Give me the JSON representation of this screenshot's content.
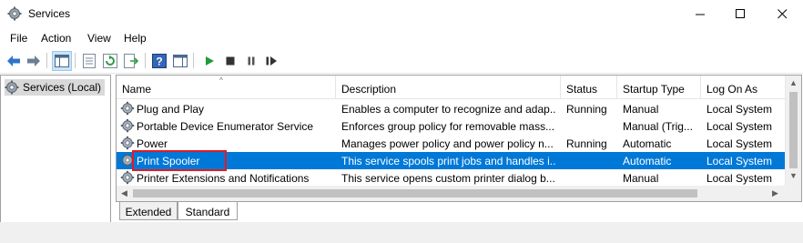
{
  "window": {
    "title": "Services",
    "minimize_glyph": "—",
    "maximize_glyph": "☐",
    "close_glyph": "✕"
  },
  "menu": [
    "File",
    "Action",
    "View",
    "Help"
  ],
  "toolbar_icons": [
    "back-icon",
    "forward-icon",
    "show-hide-console-tree-icon",
    "properties-icon",
    "refresh-icon",
    "export-list-icon",
    "help-icon",
    "show-action-pane-icon",
    "start-service-icon",
    "stop-service-icon",
    "pause-service-icon",
    "restart-service-icon"
  ],
  "tree": {
    "selected_label": "Services (Local)"
  },
  "columns": {
    "name": "Name",
    "description": "Description",
    "status": "Status",
    "startup": "Startup Type",
    "logon": "Log On As",
    "sort_glyph": "^"
  },
  "rows": [
    {
      "name": "Plug and Play",
      "description": "Enables a computer to recognize and adap...",
      "status": "Running",
      "startup": "Manual",
      "logon": "Local System"
    },
    {
      "name": "Portable Device Enumerator Service",
      "description": "Enforces group policy for removable mass...",
      "status": "",
      "startup": "Manual (Trig...",
      "logon": "Local System"
    },
    {
      "name": "Power",
      "description": "Manages power policy and power policy n...",
      "status": "Running",
      "startup": "Automatic",
      "logon": "Local System"
    },
    {
      "name": "Print Spooler",
      "description": "This service spools print jobs and handles i...",
      "status": "",
      "startup": "Automatic",
      "logon": "Local System",
      "selected": true
    },
    {
      "name": "Printer Extensions and Notifications",
      "description": "This service opens custom printer dialog b...",
      "status": "",
      "startup": "Manual",
      "logon": "Local System"
    }
  ],
  "tabs": {
    "extended": "Extended",
    "standard": "Standard"
  },
  "colors": {
    "selection": "#0078d7",
    "highlight_box": "#e21b23",
    "start_green": "#1f9c3a"
  }
}
